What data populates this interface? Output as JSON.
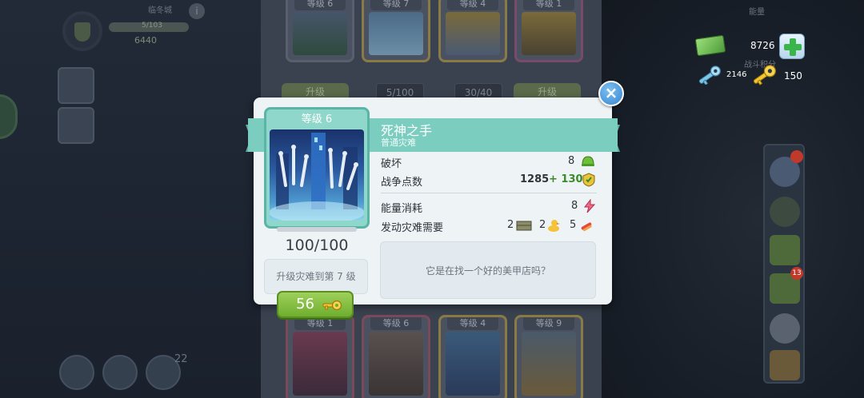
{
  "background": {
    "player": {
      "name": "临冬城",
      "bar_text": "5/103",
      "score": "6440",
      "info_icon": "i"
    },
    "round_button_number": "22",
    "top_cards": [
      {
        "level": "等级 6"
      },
      {
        "level": "等级 7"
      },
      {
        "level": "等级 4"
      },
      {
        "level": "等级 1"
      }
    ],
    "top_pills": {
      "left": "升级",
      "counter_a": "5/100",
      "counter_b": "30/40",
      "right": "升级"
    },
    "bottom_cards": [
      {
        "level": "等级 1"
      },
      {
        "level": "等级 6"
      },
      {
        "level": "等级 4"
      },
      {
        "level": "等级 9"
      }
    ],
    "energy_label": "能量",
    "battle_label": "战斗积分"
  },
  "resources": {
    "cash": "8726",
    "blue_keys": "2146",
    "gold_keys": "150"
  },
  "right_rail": {
    "badge_top": "",
    "badge_mid": "13"
  },
  "popup": {
    "card_level": "等级 6",
    "title": "死神之手",
    "subtitle": "普通灾难",
    "progress": "100/100",
    "upgrade_text": "升级灾难到第 7 级",
    "cost": "56",
    "stats": {
      "destroy_label": "破坏",
      "destroy_value": "8",
      "war_points_label": "战争点数",
      "war_points_value": "1285",
      "war_points_bonus": "+ 130",
      "energy_label": "能量消耗",
      "energy_value": "8",
      "launch_label": "发动灾难需要",
      "launch_req_1": "2",
      "launch_req_2": "2",
      "launch_req_3": "5"
    },
    "description": "它是在找一个好的美甲店吗？",
    "close_symbol": "×"
  },
  "colors": {
    "ribbon": "#7bcdc0",
    "card_border": "#5bb4a6",
    "cost_button": "#6fae2f",
    "close_button": "#3584cf"
  }
}
